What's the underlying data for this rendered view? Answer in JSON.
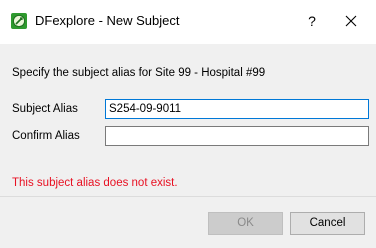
{
  "window": {
    "title": "DFexplore - New Subject",
    "help_glyph": "?",
    "close_glyph": "✕",
    "icon": "dfexplore-app-icon"
  },
  "form": {
    "prompt": "Specify the subject alias for Site 99 - Hospital #99",
    "subject_alias_label": "Subject Alias",
    "subject_alias_value": "S254-09-9011",
    "confirm_alias_label": "Confirm Alias",
    "confirm_alias_value": "",
    "error_message": "This subject alias does not exist."
  },
  "buttons": {
    "ok_label": "OK",
    "ok_enabled": false,
    "cancel_label": "Cancel"
  },
  "colors": {
    "error": "#e81123",
    "focus_border": "#0078d7",
    "icon_green": "#2e9a2e"
  }
}
